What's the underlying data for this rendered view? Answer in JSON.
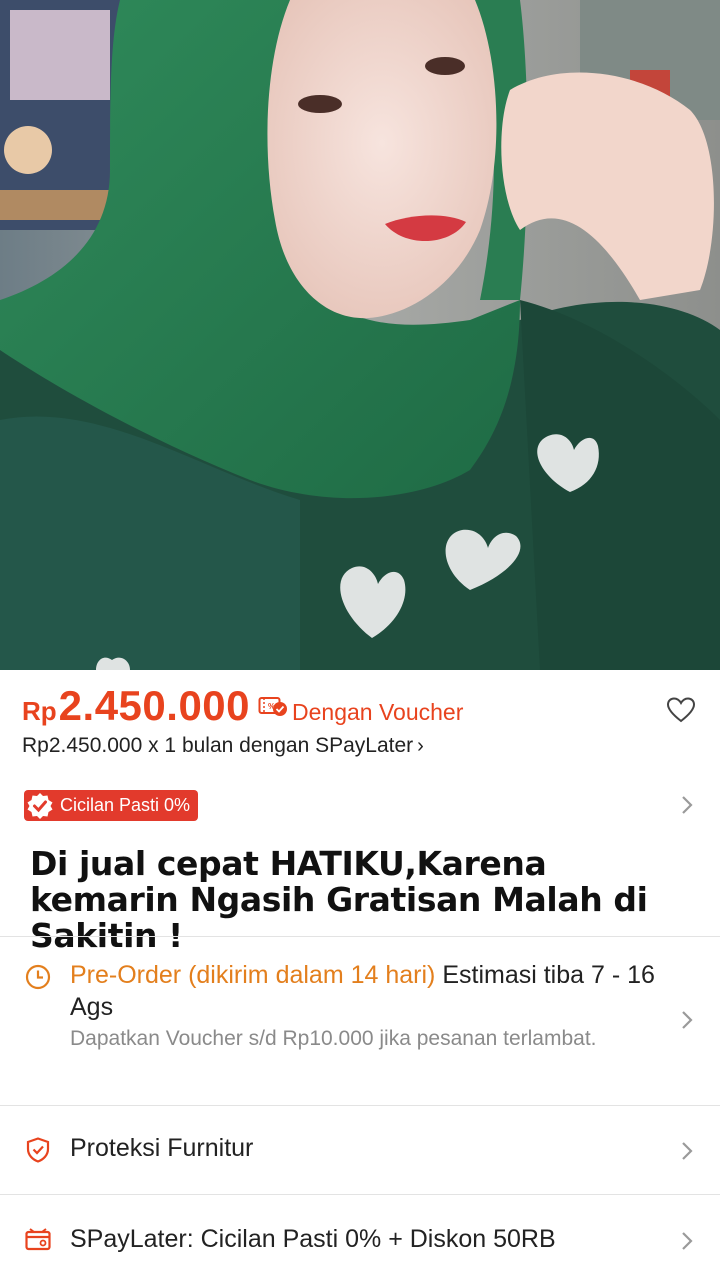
{
  "product": {
    "image_alt": "Product photo",
    "price": {
      "currency": "Rp",
      "amount": "2.450.000",
      "voucher_label": "Dengan Voucher"
    },
    "paylater_line": "Rp2.450.000 x 1 bulan dengan SPayLater",
    "badge_label": "Cicilan Pasti 0%",
    "title": "Di jual cepat HATIKU,Karena kemarin Ngasih Gratisan Malah di Sakitin !"
  },
  "shipping": {
    "preorder_label": "Pre-Order (dikirim dalam 14 hari)",
    "estimate_text": "Estimasi tiba 7 - 16 Ags",
    "voucher_note": "Dapatkan Voucher s/d Rp10.000 jika pesanan terlambat."
  },
  "protection": {
    "label": "Proteksi Furnitur"
  },
  "spaylater_promo": {
    "label": "SPayLater: Cicilan Pasti 0% + Diskon 50RB"
  },
  "colors": {
    "accent": "#e8431e",
    "badge": "#e23a2c",
    "preorder": "#e37f1d"
  }
}
